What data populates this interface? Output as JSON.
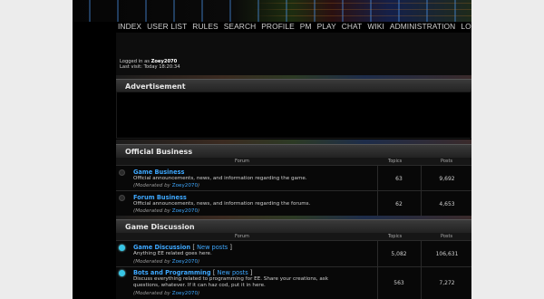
{
  "nav": [
    "INDEX",
    "USER LIST",
    "RULES",
    "SEARCH",
    "PROFILE",
    "PM",
    "PLAY",
    "CHAT",
    "WIKI",
    "ADMINISTRATION",
    "LOGOUT"
  ],
  "user": {
    "logged_in_prefix": "Logged in as",
    "username": "Zoey2070",
    "last_visit_label": "Last visit:",
    "last_visit": "Today 18:20:34"
  },
  "advertisement": {
    "title": "Advertisement"
  },
  "columns": {
    "forum": "Forum",
    "topics": "Topics",
    "posts": "Posts"
  },
  "sections": [
    {
      "title": "Official Business",
      "forums": [
        {
          "name": "Game Business",
          "description": "Official announcements, news, and information regarding the game.",
          "moderated_by": "Moderated by",
          "moderator": "Zoey2070",
          "topics": "63",
          "posts": "9,692",
          "new_posts": false
        },
        {
          "name": "Forum Business",
          "description": "Official announcements, news, and information regarding the forums.",
          "moderated_by": "Moderated by",
          "moderator": "Zoey2070",
          "topics": "62",
          "posts": "4,653",
          "new_posts": false
        }
      ]
    },
    {
      "title": "Game Discussion",
      "forums": [
        {
          "name": "Game Discussion",
          "new_label": "New posts",
          "description": "Anything EE related goes here.",
          "moderated_by": "Moderated by",
          "moderator": "Zoey2070",
          "topics": "5,082",
          "posts": "106,631",
          "new_posts": true
        },
        {
          "name": "Bots and Programming",
          "new_label": "New posts",
          "description": "Discuss everything related to programming for EE. Share your creations, ask questions, whatever. If it can haz cod, put it in here.",
          "moderated_by": "Moderated by",
          "moderator": "Zoey2070",
          "topics": "563",
          "posts": "7,272",
          "new_posts": true
        }
      ]
    }
  ]
}
